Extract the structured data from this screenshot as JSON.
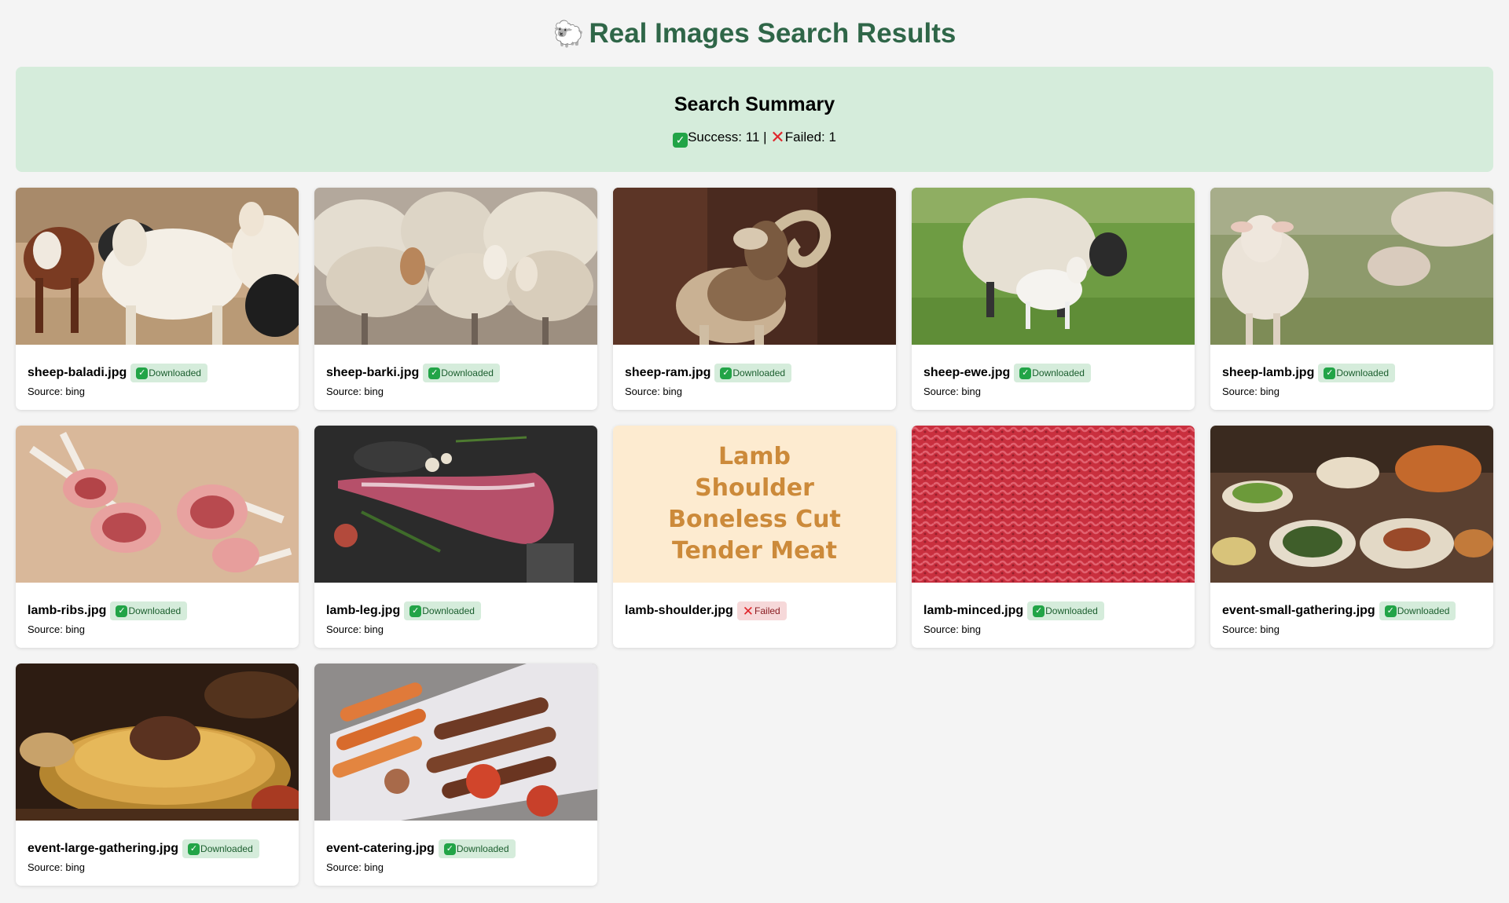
{
  "page": {
    "title_emoji": "🐑",
    "title": "Real Images Search Results"
  },
  "summary": {
    "heading": "Search Summary",
    "success_label": "Success: 11",
    "separator": "|",
    "failed_label": "Failed: 1"
  },
  "colors": {
    "title_green": "#2f6648",
    "summary_bg": "#d5ecdb",
    "success_badge_bg": "#d5ecdb",
    "failed_badge_bg": "#f6d8d9",
    "placeholder_bg": "#fdebd0",
    "placeholder_text": "#cc8a3a"
  },
  "results": [
    {
      "file": "sheep-baladi.jpg",
      "status": "Downloaded",
      "ok": true,
      "source": "Source: bing",
      "image": "cows-in-pen-photo"
    },
    {
      "file": "sheep-barki.jpg",
      "status": "Downloaded",
      "ok": true,
      "source": "Source: bing",
      "image": "sheep-flock-photo"
    },
    {
      "file": "sheep-ram.jpg",
      "status": "Downloaded",
      "ok": true,
      "source": "Source: bing",
      "image": "ram-with-horns-photo"
    },
    {
      "file": "sheep-ewe.jpg",
      "status": "Downloaded",
      "ok": true,
      "source": "Source: bing",
      "image": "ewe-and-lamb-on-grass-photo"
    },
    {
      "file": "sheep-lamb.jpg",
      "status": "Downloaded",
      "ok": true,
      "source": "Source: bing",
      "image": "lamb-on-grass-photo"
    },
    {
      "file": "lamb-ribs.jpg",
      "status": "Downloaded",
      "ok": true,
      "source": "Source: bing",
      "image": "lamb-chops-photo"
    },
    {
      "file": "lamb-leg.jpg",
      "status": "Downloaded",
      "ok": true,
      "source": "Source: bing",
      "image": "raw-lamb-leg-photo"
    },
    {
      "file": "lamb-shoulder.jpg",
      "status": "Failed",
      "ok": false,
      "source": "",
      "image": "text-placeholder",
      "placeholder_text": "Lamb Shoulder Boneless Cut Tender Meat"
    },
    {
      "file": "lamb-minced.jpg",
      "status": "Downloaded",
      "ok": true,
      "source": "Source: bing",
      "image": "minced-meat-photo"
    },
    {
      "file": "event-small-gathering.jpg",
      "status": "Downloaded",
      "ok": true,
      "source": "Source: bing",
      "image": "feast-table-photo"
    },
    {
      "file": "event-large-gathering.jpg",
      "status": "Downloaded",
      "ok": true,
      "source": "Source: bing",
      "image": "rice-and-lamb-platter-photo"
    },
    {
      "file": "event-catering.jpg",
      "status": "Downloaded",
      "ok": true,
      "source": "Source: bing",
      "image": "grilled-kebab-platter-photo"
    }
  ]
}
